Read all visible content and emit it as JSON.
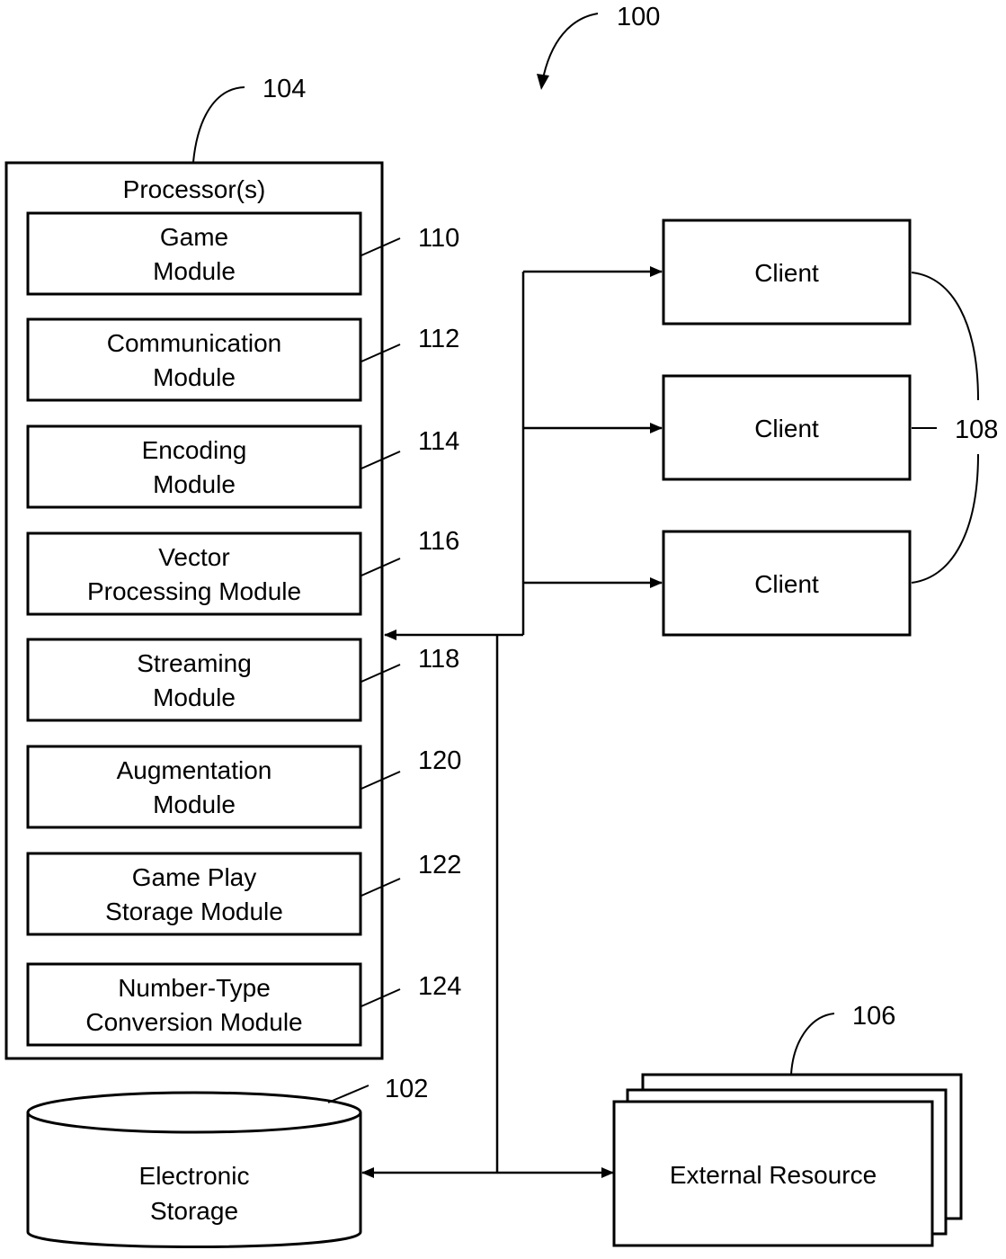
{
  "figure": {
    "ref": "100",
    "processor": {
      "ref": "104",
      "title": "Processor(s)",
      "modules": [
        {
          "ref": "110",
          "lines": [
            "Game",
            "Module"
          ]
        },
        {
          "ref": "112",
          "lines": [
            "Communication",
            "Module"
          ]
        },
        {
          "ref": "114",
          "lines": [
            "Encoding",
            "Module"
          ]
        },
        {
          "ref": "116",
          "lines": [
            "Vector",
            "Processing Module"
          ]
        },
        {
          "ref": "118",
          "lines": [
            "Streaming",
            "Module"
          ]
        },
        {
          "ref": "120",
          "lines": [
            "Augmentation",
            "Module"
          ]
        },
        {
          "ref": "122",
          "lines": [
            "Game Play",
            "Storage Module"
          ]
        },
        {
          "ref": "124",
          "lines": [
            "Number-Type",
            "Conversion Module"
          ]
        }
      ]
    },
    "clients": {
      "ref": "108",
      "items": [
        {
          "label": "Client"
        },
        {
          "label": "Client"
        },
        {
          "label": "Client"
        }
      ]
    },
    "storage": {
      "ref": "102",
      "lines": [
        "Electronic",
        "Storage"
      ]
    },
    "external": {
      "ref": "106",
      "label": "External Resource"
    }
  }
}
